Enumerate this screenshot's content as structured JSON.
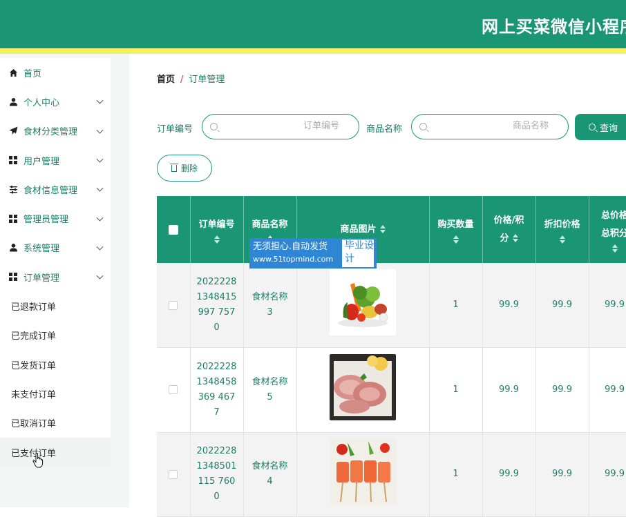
{
  "header": {
    "title": "网上买菜微信小程序"
  },
  "sidebar": {
    "items": [
      {
        "label": "首页",
        "icon": "home-icon"
      },
      {
        "label": "个人中心",
        "icon": "user-icon"
      },
      {
        "label": "食材分类管理",
        "icon": "send-icon"
      },
      {
        "label": "用户管理",
        "icon": "grid-icon"
      },
      {
        "label": "食材信息管理",
        "icon": "sliders-icon"
      },
      {
        "label": "管理员管理",
        "icon": "grid-icon"
      },
      {
        "label": "系统管理",
        "icon": "user-icon"
      },
      {
        "label": "订单管理",
        "icon": "grid-icon"
      }
    ],
    "sub_items": [
      "已退款订单",
      "已完成订单",
      "已发货订单",
      "未支付订单",
      "已取消订单",
      "已支付订单"
    ]
  },
  "breadcrumb": {
    "home": "首页",
    "separator": "/",
    "current": "订单管理"
  },
  "search": {
    "order_label": "订单编号",
    "order_placeholder": "订单编号",
    "name_label": "商品名称",
    "name_placeholder": "商品名称",
    "query_label": "查询"
  },
  "actions": {
    "delete_label": "删除"
  },
  "table": {
    "headers": {
      "order_no": "订单编号",
      "product_name": "商品名称",
      "product_pic": "商品图片",
      "quantity": "购买数量",
      "price_points_1": "价格/积",
      "price_points_2": "分",
      "discount_price": "折扣价格",
      "total_1": "总价格",
      "total_2": "总积分"
    },
    "rows": [
      {
        "order_no": "20222281348415997 7570",
        "name_1": "食材名称",
        "name_2": "3",
        "quantity": "1",
        "price": "99.9",
        "discount": "99.9",
        "total": "99.9"
      },
      {
        "order_no": "20222281348458369 4677",
        "name_1": "食材名称",
        "name_2": "5",
        "quantity": "1",
        "price": "99.9",
        "discount": "99.9",
        "total": "99.9"
      },
      {
        "order_no": "20222281348501115 7600",
        "name_1": "食材名称",
        "name_2": "4",
        "quantity": "1",
        "price": "99.9",
        "discount": "99.9",
        "total": "99.9"
      }
    ]
  },
  "watermark": {
    "line1": "无须担心.自动发货",
    "url": "www.51topmind.com",
    "right": "毕业设计"
  },
  "colors": {
    "primary": "#1b9674",
    "accent_yellow": "#f5ef62",
    "text_green": "#1e7d62",
    "watermark_blue": "#2f86d4"
  }
}
